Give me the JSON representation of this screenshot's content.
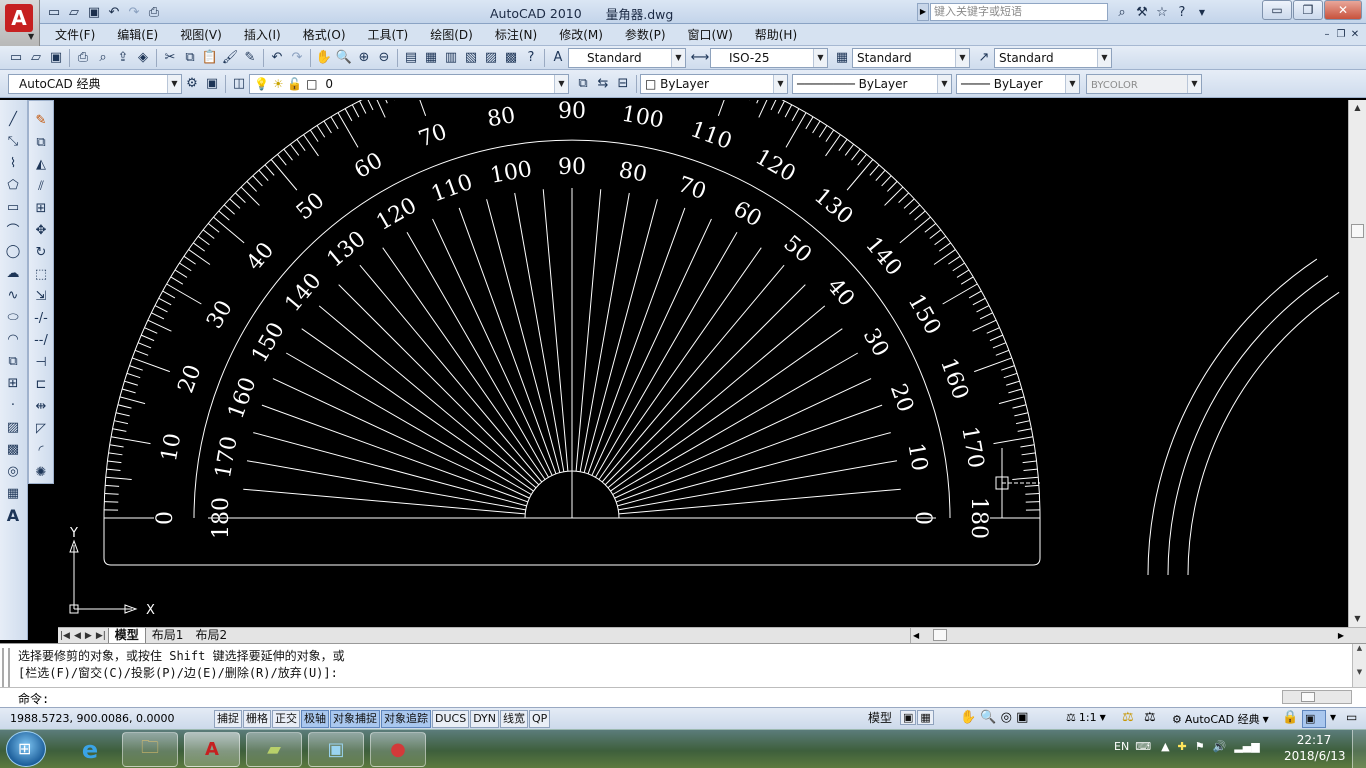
{
  "window": {
    "app_name": "AutoCAD 2010",
    "file_name": "量角器.dwg",
    "search_placeholder": "键入关键字或短语",
    "minimize": "▭",
    "restore": "❐",
    "close": "✕"
  },
  "menu": [
    "文件(F)",
    "编辑(E)",
    "视图(V)",
    "插入(I)",
    "格式(O)",
    "工具(T)",
    "绘图(D)",
    "标注(N)",
    "修改(M)",
    "参数(P)",
    "窗口(W)",
    "帮助(H)"
  ],
  "styles": {
    "text_style": "Standard",
    "dim_style": "ISO-25",
    "table_style": "Standard",
    "multileader_style": "Standard"
  },
  "workspace": "AutoCAD 经典",
  "layer": "0",
  "properties": {
    "color": "ByLayer",
    "linetype": "ByLayer",
    "lineweight": "ByLayer",
    "plot_style": "BYCOLOR"
  },
  "layout_tabs": [
    "模型",
    "布局1",
    "布局2"
  ],
  "command": {
    "line1": "选择要修剪的对象，或按住 Shift 键选择要延伸的对象，或",
    "line2": "[栏选(F)/窗交(C)/投影(P)/边(E)/删除(R)/放弃(U)]:",
    "prompt": "命令:"
  },
  "status": {
    "coordinates": "1988.5723, 900.0086, 0.0000",
    "toggles": [
      {
        "label": "捕捉",
        "on": false
      },
      {
        "label": "栅格",
        "on": false
      },
      {
        "label": "正交",
        "on": false
      },
      {
        "label": "极轴",
        "on": true
      },
      {
        "label": "对象捕捉",
        "on": true
      },
      {
        "label": "对象追踪",
        "on": true
      },
      {
        "label": "DUCS",
        "on": false
      },
      {
        "label": "DYN",
        "on": false
      },
      {
        "label": "线宽",
        "on": false
      },
      {
        "label": "QP",
        "on": false
      }
    ],
    "model_label": "模型",
    "scale": "1:1",
    "workspace": "AutoCAD 经典"
  },
  "axes": {
    "x_label": "X",
    "y_label": "Y"
  },
  "protractor": {
    "outer_scale_labels": [
      "0",
      "10",
      "20",
      "30",
      "40",
      "50",
      "60",
      "70",
      "80",
      "90",
      "100",
      "110",
      "120",
      "130",
      "140",
      "150",
      "160",
      "170",
      "180"
    ],
    "inner_scale_labels": [
      "180",
      "170",
      "160",
      "150",
      "140",
      "130",
      "120",
      "110",
      "100",
      "90",
      "80",
      "70",
      "60",
      "50",
      "40",
      "30",
      "20",
      "10",
      "0"
    ],
    "degree_step": 10,
    "colors": {
      "line": "#ffffff",
      "background": "#000000"
    }
  },
  "taskbar": {
    "language": "EN",
    "time": "22:17",
    "date": "2018/6/13"
  }
}
